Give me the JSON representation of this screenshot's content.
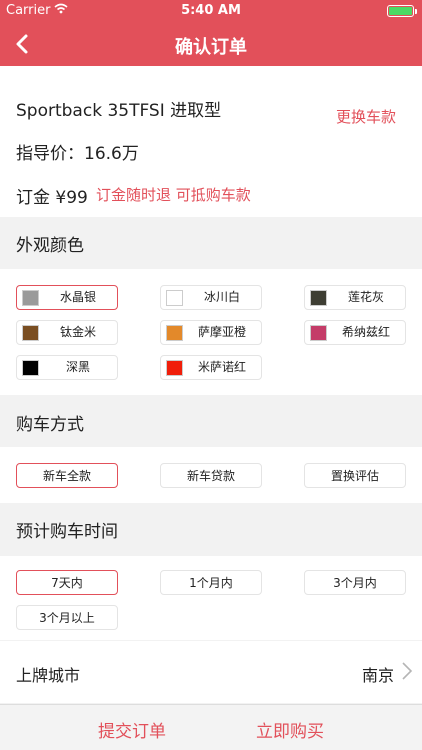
{
  "status": {
    "carrier": "Carrier",
    "time": "5:40 AM"
  },
  "nav": {
    "title": "确认订单"
  },
  "car": {
    "model": "Sportback 35TFSI 进取型",
    "change_label": "更换车款",
    "guide_price": "指导价：16.6万",
    "deposit": "订金 ¥99",
    "deposit_note": "订金随时退  可抵购车款"
  },
  "exterior": {
    "title": "外观颜色",
    "colors": [
      {
        "name": "水晶银",
        "color": "#9a9a9a",
        "selected": true
      },
      {
        "name": "冰川白",
        "color": "#ffffff",
        "selected": false
      },
      {
        "name": "莲花灰",
        "color": "#3e3e33",
        "selected": false
      },
      {
        "name": "钛金米",
        "color": "#7a4e22",
        "selected": false
      },
      {
        "name": "萨摩亚橙",
        "color": "#e3892a",
        "selected": false
      },
      {
        "name": "希纳兹红",
        "color": "#c43c68",
        "selected": false
      },
      {
        "name": "深黑",
        "color": "#000000",
        "selected": false
      },
      {
        "name": "米萨诺红",
        "color": "#f01e0a",
        "selected": false
      }
    ]
  },
  "purchase": {
    "title": "购车方式",
    "options": [
      {
        "label": "新车全款",
        "selected": true
      },
      {
        "label": "新车贷款",
        "selected": false
      },
      {
        "label": "置换评估",
        "selected": false
      }
    ]
  },
  "timing": {
    "title": "预计购车时间",
    "options": [
      {
        "label": "7天内",
        "selected": true
      },
      {
        "label": "1个月内",
        "selected": false
      },
      {
        "label": "3个月内",
        "selected": false
      },
      {
        "label": "3个月以上",
        "selected": false
      }
    ]
  },
  "city": {
    "label": "上牌城市",
    "value": "南京"
  },
  "bottom": {
    "submit_label": "提交订单",
    "buy_label": "立即购买"
  },
  "theme": {
    "accent": "#e2505a"
  }
}
